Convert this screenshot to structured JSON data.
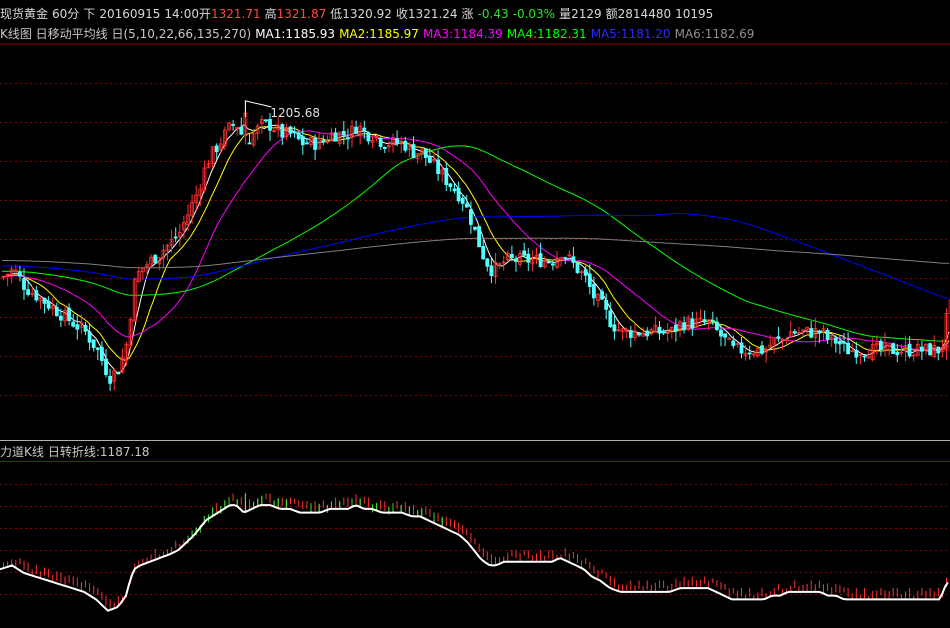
{
  "colors": {
    "background": "#000000",
    "grid": "#8b0000",
    "up": "#ff3232",
    "down": "#54ffff",
    "ma1": "#ffffff",
    "ma2": "#ffff00",
    "ma3": "#ff00ff",
    "ma4": "#00ff00",
    "ma5": "#0000ff",
    "ma6": "#808080",
    "turn_line": "#ffffff"
  },
  "info": {
    "instrument": "现货黄金",
    "period": "60分",
    "direction": "下",
    "date": "20160915",
    "time": "14:00",
    "open_label": "开",
    "open": "1321.71",
    "high_label": "高",
    "high": "1321.87",
    "low_label": "低",
    "low": "1320.92",
    "close_label": "收",
    "close": "1321.24",
    "change_label": "涨",
    "change": "-0.43",
    "change_pct": "-0.03%",
    "volume_label": "量",
    "volume": "2129",
    "amount_label": "额",
    "amount": "2814480",
    "extra": "10195"
  },
  "ma_bar": {
    "prefix": "K线图 日移动平均线 日(5,10,22,66,135,270)",
    "ma1": "MA1:1185.93",
    "ma2": "MA2:1185.97",
    "ma3": "MA3:1184.39",
    "ma4": "MA4:1182.31",
    "ma5": "MA5:1181.20",
    "ma6": "MA6:1182.69"
  },
  "indicator_bar": {
    "title": "力道K线",
    "turn": "日转折线:1187.18"
  },
  "chart_data": {
    "type": "candlestick",
    "annotations": [
      {
        "label": "1205.68",
        "note": "maximum high"
      }
    ],
    "price_pane": {
      "series": [
        {
          "name": "MA1",
          "period": 5
        },
        {
          "name": "MA2",
          "period": 10
        },
        {
          "name": "MA3",
          "period": 22
        },
        {
          "name": "MA4",
          "period": 66
        },
        {
          "name": "MA5",
          "period": 135
        },
        {
          "name": "MA6",
          "period": 270
        }
      ],
      "close_path": [
        [
          0,
          1186
        ],
        [
          12,
          1187
        ],
        [
          24,
          1185
        ],
        [
          36,
          1184
        ],
        [
          48,
          1183
        ],
        [
          60,
          1182
        ],
        [
          72,
          1181
        ],
        [
          84,
          1180
        ],
        [
          96,
          1178
        ],
        [
          108,
          1175
        ],
        [
          118,
          1176
        ],
        [
          126,
          1179
        ],
        [
          130,
          1183
        ],
        [
          134,
          1186
        ],
        [
          140,
          1187
        ],
        [
          150,
          1188
        ],
        [
          160,
          1189
        ],
        [
          170,
          1190
        ],
        [
          178,
          1191
        ],
        [
          186,
          1193
        ],
        [
          194,
          1195
        ],
        [
          200,
          1197
        ],
        [
          206,
          1199
        ],
        [
          212,
          1200
        ],
        [
          218,
          1201
        ],
        [
          224,
          1202
        ],
        [
          230,
          1203
        ],
        [
          236,
          1203
        ],
        [
          244,
          1201
        ],
        [
          252,
          1202
        ],
        [
          260,
          1203
        ],
        [
          270,
          1203
        ],
        [
          280,
          1202
        ],
        [
          290,
          1202
        ],
        [
          300,
          1201
        ],
        [
          310,
          1201
        ],
        [
          320,
          1201
        ],
        [
          330,
          1202
        ],
        [
          340,
          1202
        ],
        [
          348,
          1202
        ],
        [
          356,
          1203
        ],
        [
          364,
          1202
        ],
        [
          372,
          1202
        ],
        [
          382,
          1201
        ],
        [
          392,
          1201
        ],
        [
          402,
          1201
        ],
        [
          412,
          1200
        ],
        [
          420,
          1200
        ],
        [
          428,
          1199
        ],
        [
          436,
          1198
        ],
        [
          444,
          1197
        ],
        [
          452,
          1196
        ],
        [
          460,
          1195
        ],
        [
          468,
          1193
        ],
        [
          474,
          1191
        ],
        [
          480,
          1189
        ],
        [
          484,
          1188
        ],
        [
          490,
          1187
        ],
        [
          496,
          1187
        ],
        [
          504,
          1188
        ],
        [
          512,
          1188
        ],
        [
          520,
          1188
        ],
        [
          528,
          1188
        ],
        [
          536,
          1188
        ],
        [
          544,
          1188
        ],
        [
          552,
          1188
        ],
        [
          560,
          1189
        ],
        [
          568,
          1188
        ],
        [
          576,
          1187
        ],
        [
          584,
          1186
        ],
        [
          592,
          1184
        ],
        [
          600,
          1183
        ],
        [
          610,
          1181
        ],
        [
          620,
          1180
        ],
        [
          630,
          1180
        ],
        [
          640,
          1180
        ],
        [
          650,
          1180
        ],
        [
          660,
          1180
        ],
        [
          670,
          1180
        ],
        [
          680,
          1181
        ],
        [
          690,
          1181
        ],
        [
          700,
          1181
        ],
        [
          708,
          1181
        ],
        [
          716,
          1180
        ],
        [
          724,
          1179
        ],
        [
          732,
          1178
        ],
        [
          740,
          1178
        ],
        [
          748,
          1178
        ],
        [
          756,
          1178
        ],
        [
          764,
          1178
        ],
        [
          772,
          1179
        ],
        [
          780,
          1179
        ],
        [
          788,
          1180
        ],
        [
          796,
          1180
        ],
        [
          804,
          1180
        ],
        [
          812,
          1180
        ],
        [
          820,
          1180
        ],
        [
          828,
          1179
        ],
        [
          836,
          1179
        ],
        [
          844,
          1178
        ],
        [
          852,
          1178
        ],
        [
          860,
          1178
        ],
        [
          868,
          1178
        ],
        [
          876,
          1178
        ],
        [
          884,
          1178
        ],
        [
          892,
          1178
        ],
        [
          900,
          1178
        ],
        [
          908,
          1178
        ],
        [
          916,
          1178
        ],
        [
          924,
          1178
        ],
        [
          932,
          1178
        ],
        [
          940,
          1178
        ],
        [
          946,
          1182
        ],
        [
          950,
          1183
        ]
      ]
    },
    "indicator_pane": {
      "series": [
        {
          "name": "日转折线",
          "last": 1187.18
        }
      ]
    }
  }
}
